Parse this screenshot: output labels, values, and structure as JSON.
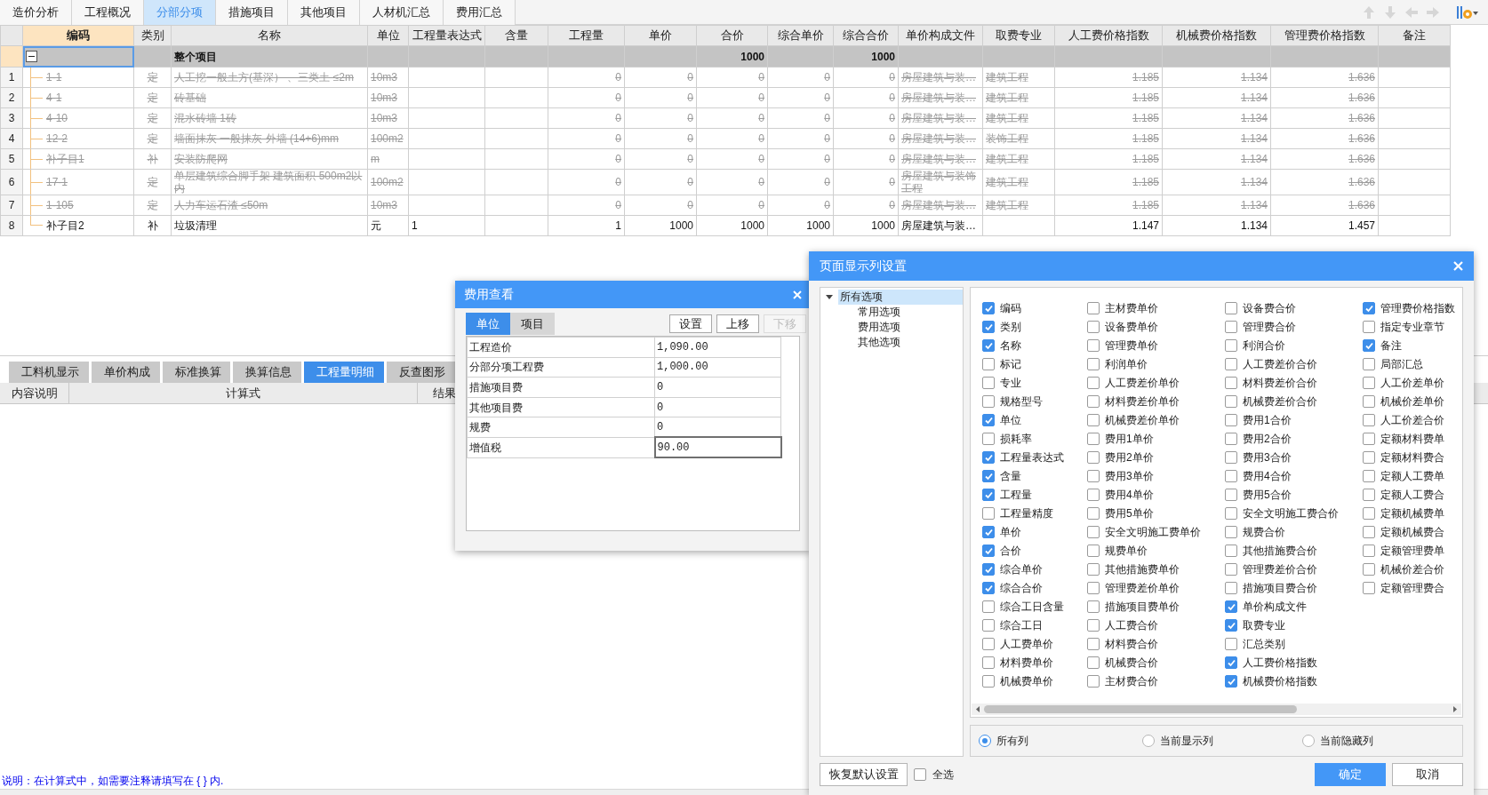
{
  "top_tabs": [
    {
      "label": "造价分析",
      "selected": false
    },
    {
      "label": "工程概况",
      "selected": false
    },
    {
      "label": "分部分项",
      "selected": true
    },
    {
      "label": "措施项目",
      "selected": false
    },
    {
      "label": "其他项目",
      "selected": false
    },
    {
      "label": "人材机汇总",
      "selected": false
    },
    {
      "label": "费用汇总",
      "selected": false
    }
  ],
  "grid": {
    "columns": [
      {
        "label": "编码",
        "selected": true
      },
      {
        "label": "类别",
        "selected": false
      },
      {
        "label": "名称",
        "selected": false
      },
      {
        "label": "单位",
        "selected": false
      },
      {
        "label": "工程量表达式",
        "selected": false
      },
      {
        "label": "含量",
        "selected": false
      },
      {
        "label": "工程量",
        "selected": false
      },
      {
        "label": "单价",
        "selected": false
      },
      {
        "label": "合价",
        "selected": false
      },
      {
        "label": "综合单价",
        "selected": false
      },
      {
        "label": "综合合价",
        "selected": false
      },
      {
        "label": "单价构成文件",
        "selected": false
      },
      {
        "label": "取费专业",
        "selected": false
      },
      {
        "label": "人工费价格指数",
        "selected": false
      },
      {
        "label": "机械费价格指数",
        "selected": false
      },
      {
        "label": "管理费价格指数",
        "selected": false
      },
      {
        "label": "备注",
        "selected": false
      }
    ],
    "rows": [
      {
        "kind": "summary",
        "selected": true,
        "expanded": true,
        "struck": false,
        "cells": [
          "",
          "",
          "整个项目",
          "",
          "",
          "",
          "",
          "",
          "1000",
          "",
          "1000",
          "",
          "",
          "",
          "",
          "",
          ""
        ]
      },
      {
        "kind": "item",
        "num": "1",
        "selected": false,
        "struck": true,
        "cells": [
          "1-1",
          "定",
          "人工挖一般土方(基深） 、三类土 ≤2m",
          "10m3",
          "",
          "",
          "0",
          "0",
          "0",
          "0",
          "0",
          "房屋建筑与装…",
          "建筑工程",
          "1.185",
          "1.134",
          "1.636",
          ""
        ]
      },
      {
        "kind": "item",
        "num": "2",
        "selected": false,
        "struck": true,
        "cells": [
          "4-1",
          "定",
          "砖基础",
          "10m3",
          "",
          "",
          "0",
          "0",
          "0",
          "0",
          "0",
          "房屋建筑与装…",
          "建筑工程",
          "1.185",
          "1.134",
          "1.636",
          ""
        ]
      },
      {
        "kind": "item",
        "num": "3",
        "selected": false,
        "struck": true,
        "cells": [
          "4-10",
          "定",
          "混水砖墙 1砖",
          "10m3",
          "",
          "",
          "0",
          "0",
          "0",
          "0",
          "0",
          "房屋建筑与装…",
          "建筑工程",
          "1.185",
          "1.134",
          "1.636",
          ""
        ]
      },
      {
        "kind": "item",
        "num": "4",
        "selected": false,
        "struck": true,
        "cells": [
          "12-2",
          "定",
          "墙面抹灰 一般抹灰 外墙 (14+6)mm",
          "100m2",
          "",
          "",
          "0",
          "0",
          "0",
          "0",
          "0",
          "房屋建筑与装…",
          "装饰工程",
          "1.185",
          "1.134",
          "1.636",
          ""
        ]
      },
      {
        "kind": "item",
        "num": "5",
        "selected": false,
        "struck": true,
        "cells": [
          "补子目1",
          "补",
          "安装防爬网",
          "m",
          "",
          "",
          "0",
          "0",
          "0",
          "0",
          "0",
          "房屋建筑与装…",
          "建筑工程",
          "1.185",
          "1.134",
          "1.636",
          ""
        ]
      },
      {
        "kind": "item",
        "num": "6",
        "selected": false,
        "struck": true,
        "cells": [
          "17-1",
          "定",
          "单层建筑综合脚手架 建筑面积 500m2以内",
          "100m2",
          "",
          "",
          "0",
          "0",
          "0",
          "0",
          "0",
          "房屋建筑与装饰工程",
          "建筑工程",
          "1.185",
          "1.134",
          "1.636",
          ""
        ]
      },
      {
        "kind": "item",
        "num": "7",
        "selected": false,
        "struck": true,
        "cells": [
          "1-105",
          "定",
          "人力车运石渣 ≤50m",
          "10m3",
          "",
          "",
          "0",
          "0",
          "0",
          "0",
          "0",
          "房屋建筑与装…",
          "建筑工程",
          "1.185",
          "1.134",
          "1.636",
          ""
        ]
      },
      {
        "kind": "item",
        "num": "8",
        "selected": false,
        "struck": false,
        "cells": [
          "补子目2",
          "补",
          "垃圾清理",
          "元",
          "1",
          "",
          "1",
          "1000",
          "1000",
          "1000",
          "1000",
          "房屋建筑与装…",
          "",
          "1.147",
          "1.134",
          "1.457",
          ""
        ]
      }
    ]
  },
  "bottom_panel": {
    "tabs": [
      {
        "label": "工料机显示",
        "selected": false
      },
      {
        "label": "单价构成",
        "selected": false
      },
      {
        "label": "标准换算",
        "selected": false
      },
      {
        "label": "换算信息",
        "selected": false
      },
      {
        "label": "工程量明细",
        "selected": true
      },
      {
        "label": "反查图形",
        "selected": false
      }
    ],
    "columns": [
      "内容说明",
      "计算式",
      "结果"
    ],
    "note": "说明：在计算式中，如需要注释请填写在 { } 内."
  },
  "fee_dialog": {
    "title": "费用查看",
    "tabs": [
      {
        "label": "单位",
        "selected": true
      },
      {
        "label": "项目",
        "selected": false
      }
    ],
    "buttons": [
      {
        "label": "设置",
        "disabled": false
      },
      {
        "label": "上移",
        "disabled": false
      },
      {
        "label": "下移",
        "disabled": true
      }
    ],
    "rows": [
      {
        "name": "工程造价",
        "value": "1,090.00",
        "selected": false
      },
      {
        "name": "分部分项工程费",
        "value": "1,000.00",
        "selected": false
      },
      {
        "name": "措施项目费",
        "value": "0",
        "selected": false
      },
      {
        "name": "其他项目费",
        "value": "0",
        "selected": false
      },
      {
        "name": "规费",
        "value": "0",
        "selected": false
      },
      {
        "name": "增值税",
        "value": "90.00",
        "selected": true
      }
    ]
  },
  "column_dialog": {
    "title": "页面显示列设置",
    "tree": [
      {
        "label": "所有选项",
        "expanded": true,
        "selected": true,
        "children": [
          {
            "label": "常用选项",
            "selected": false
          },
          {
            "label": "费用选项",
            "selected": false
          },
          {
            "label": "其他选项",
            "selected": false
          }
        ]
      }
    ],
    "option_columns": [
      {
        "items": [
          {
            "label": "编码",
            "checked": true
          },
          {
            "label": "类别",
            "checked": true
          },
          {
            "label": "名称",
            "checked": true
          },
          {
            "label": "标记",
            "checked": false
          },
          {
            "label": "专业",
            "checked": false
          },
          {
            "label": "规格型号",
            "checked": false
          },
          {
            "label": "单位",
            "checked": true
          },
          {
            "label": "损耗率",
            "checked": false
          },
          {
            "label": "工程量表达式",
            "checked": true
          },
          {
            "label": "含量",
            "checked": true
          },
          {
            "label": "工程量",
            "checked": true
          },
          {
            "label": "工程量精度",
            "checked": false
          },
          {
            "label": "单价",
            "checked": true
          },
          {
            "label": "合价",
            "checked": true
          },
          {
            "label": "综合单价",
            "checked": true
          },
          {
            "label": "综合合价",
            "checked": true
          },
          {
            "label": "综合工日含量",
            "checked": false
          },
          {
            "label": "综合工日",
            "checked": false
          },
          {
            "label": "人工费单价",
            "checked": false
          },
          {
            "label": "材料费单价",
            "checked": false
          },
          {
            "label": "机械费单价",
            "checked": false
          }
        ]
      },
      {
        "items": [
          {
            "label": "主材费单价",
            "checked": false
          },
          {
            "label": "设备费单价",
            "checked": false
          },
          {
            "label": "管理费单价",
            "checked": false
          },
          {
            "label": "利润单价",
            "checked": false
          },
          {
            "label": "人工费差价单价",
            "checked": false
          },
          {
            "label": "材料费差价单价",
            "checked": false
          },
          {
            "label": "机械费差价单价",
            "checked": false
          },
          {
            "label": "费用1单价",
            "checked": false
          },
          {
            "label": "费用2单价",
            "checked": false
          },
          {
            "label": "费用3单价",
            "checked": false
          },
          {
            "label": "费用4单价",
            "checked": false
          },
          {
            "label": "费用5单价",
            "checked": false
          },
          {
            "label": "安全文明施工费单价",
            "checked": false
          },
          {
            "label": "规费单价",
            "checked": false
          },
          {
            "label": "其他措施费单价",
            "checked": false
          },
          {
            "label": "管理费差价单价",
            "checked": false
          },
          {
            "label": "措施项目费单价",
            "checked": false
          },
          {
            "label": "人工费合价",
            "checked": false
          },
          {
            "label": "材料费合价",
            "checked": false
          },
          {
            "label": "机械费合价",
            "checked": false
          },
          {
            "label": "主材费合价",
            "checked": false
          }
        ]
      },
      {
        "items": [
          {
            "label": "设备费合价",
            "checked": false
          },
          {
            "label": "管理费合价",
            "checked": false
          },
          {
            "label": "利润合价",
            "checked": false
          },
          {
            "label": "人工费差价合价",
            "checked": false
          },
          {
            "label": "材料费差价合价",
            "checked": false
          },
          {
            "label": "机械费差价合价",
            "checked": false
          },
          {
            "label": "费用1合价",
            "checked": false
          },
          {
            "label": "费用2合价",
            "checked": false
          },
          {
            "label": "费用3合价",
            "checked": false
          },
          {
            "label": "费用4合价",
            "checked": false
          },
          {
            "label": "费用5合价",
            "checked": false
          },
          {
            "label": "安全文明施工费合价",
            "checked": false
          },
          {
            "label": "规费合价",
            "checked": false
          },
          {
            "label": "其他措施费合价",
            "checked": false
          },
          {
            "label": "管理费差价合价",
            "checked": false
          },
          {
            "label": "措施项目费合价",
            "checked": false
          },
          {
            "label": "单价构成文件",
            "checked": true
          },
          {
            "label": "取费专业",
            "checked": true
          },
          {
            "label": "汇总类别",
            "checked": false
          },
          {
            "label": "人工费价格指数",
            "checked": true
          },
          {
            "label": "机械费价格指数",
            "checked": true
          }
        ]
      },
      {
        "items": [
          {
            "label": "管理费价格指数",
            "checked": true
          },
          {
            "label": "指定专业章节",
            "checked": false
          },
          {
            "label": "备注",
            "checked": true
          },
          {
            "label": "局部汇总",
            "checked": false
          },
          {
            "label": "人工价差单价",
            "checked": false
          },
          {
            "label": "机械价差单价",
            "checked": false
          },
          {
            "label": "人工价差合价",
            "checked": false
          },
          {
            "label": "定额材料费单",
            "checked": false
          },
          {
            "label": "定额材料费合",
            "checked": false
          },
          {
            "label": "定额人工费单",
            "checked": false
          },
          {
            "label": "定额人工费合",
            "checked": false
          },
          {
            "label": "定额机械费单",
            "checked": false
          },
          {
            "label": "定额机械费合",
            "checked": false
          },
          {
            "label": "定额管理费单",
            "checked": false
          },
          {
            "label": "机械价差合价",
            "checked": false
          },
          {
            "label": "定额管理费合",
            "checked": false
          }
        ]
      }
    ],
    "filters": [
      {
        "label": "所有列",
        "selected": true
      },
      {
        "label": "当前显示列",
        "selected": false
      },
      {
        "label": "当前隐藏列",
        "selected": false
      }
    ],
    "reset_button": "恢复默认设置",
    "select_all": {
      "label": "全选",
      "checked": false
    },
    "ok_button": "确定",
    "cancel_button": "取消"
  }
}
